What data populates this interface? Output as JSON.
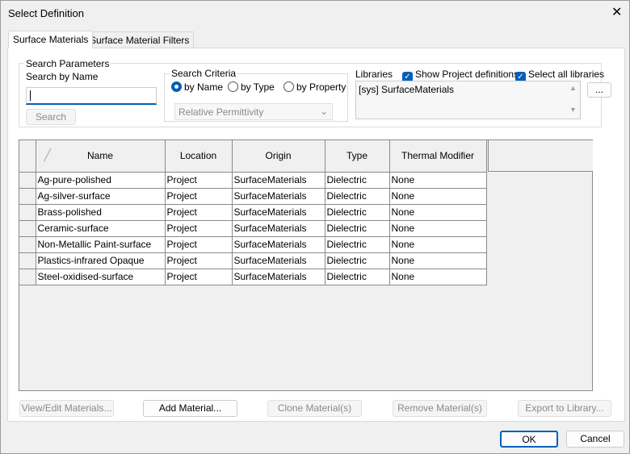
{
  "window": {
    "title": "Select Definition",
    "close": "✕"
  },
  "tabs": [
    {
      "label": "Surface Materials",
      "active": true
    },
    {
      "label": "Surface Material Filters",
      "active": false
    }
  ],
  "search": {
    "group_label": "Search Parameters",
    "by_name_label": "Search by Name",
    "value": "",
    "button": "Search"
  },
  "criteria": {
    "label": "Search Criteria",
    "options": [
      "by Name",
      "by Type",
      "by Property"
    ],
    "selected": "by Name",
    "property_select": "Relative Permittivity"
  },
  "libraries": {
    "label": "Libraries",
    "show_project": "Show Project definitions",
    "show_project_checked": true,
    "select_all": "Select all libraries",
    "select_all_checked": true,
    "items": [
      "[sys] SurfaceMaterials"
    ],
    "browse": "..."
  },
  "table": {
    "columns": [
      "Name",
      "Location",
      "Origin",
      "Type",
      "Thermal Modifier"
    ],
    "rows": [
      [
        "Ag-pure-polished",
        "Project",
        "SurfaceMaterials",
        "Dielectric",
        "None"
      ],
      [
        "Ag-silver-surface",
        "Project",
        "SurfaceMaterials",
        "Dielectric",
        "None"
      ],
      [
        "Brass-polished",
        "Project",
        "SurfaceMaterials",
        "Dielectric",
        "None"
      ],
      [
        "Ceramic-surface",
        "Project",
        "SurfaceMaterials",
        "Dielectric",
        "None"
      ],
      [
        "Non-Metallic Paint-surface",
        "Project",
        "SurfaceMaterials",
        "Dielectric",
        "None"
      ],
      [
        "Plastics-infrared Opaque",
        "Project",
        "SurfaceMaterials",
        "Dielectric",
        "None"
      ],
      [
        "Steel-oxidised-surface",
        "Project",
        "SurfaceMaterials",
        "Dielectric",
        "None"
      ]
    ]
  },
  "actions": {
    "view_edit": "View/Edit Materials...",
    "add": "Add Material...",
    "clone": "Clone Material(s)",
    "remove": "Remove Material(s)",
    "export": "Export to Library..."
  },
  "footer": {
    "ok": "OK",
    "cancel": "Cancel"
  }
}
